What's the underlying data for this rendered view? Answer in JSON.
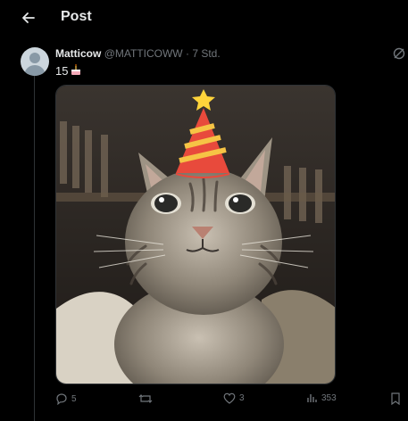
{
  "header": {
    "title": "Post"
  },
  "post": {
    "author_name": "Matticow",
    "handle": "@MATTICOWW",
    "separator": "·",
    "time": "7 Std.",
    "text": "15",
    "emoji_icon": "birthday-cake-icon",
    "media_description_icon": "cat-with-party-hat"
  },
  "actions": {
    "replies": "5",
    "reposts": "",
    "likes": "3",
    "views": "353"
  },
  "colors": {
    "background": "#000000",
    "text": "#e7e9ea",
    "muted": "#71767b",
    "border": "#2f3336"
  }
}
